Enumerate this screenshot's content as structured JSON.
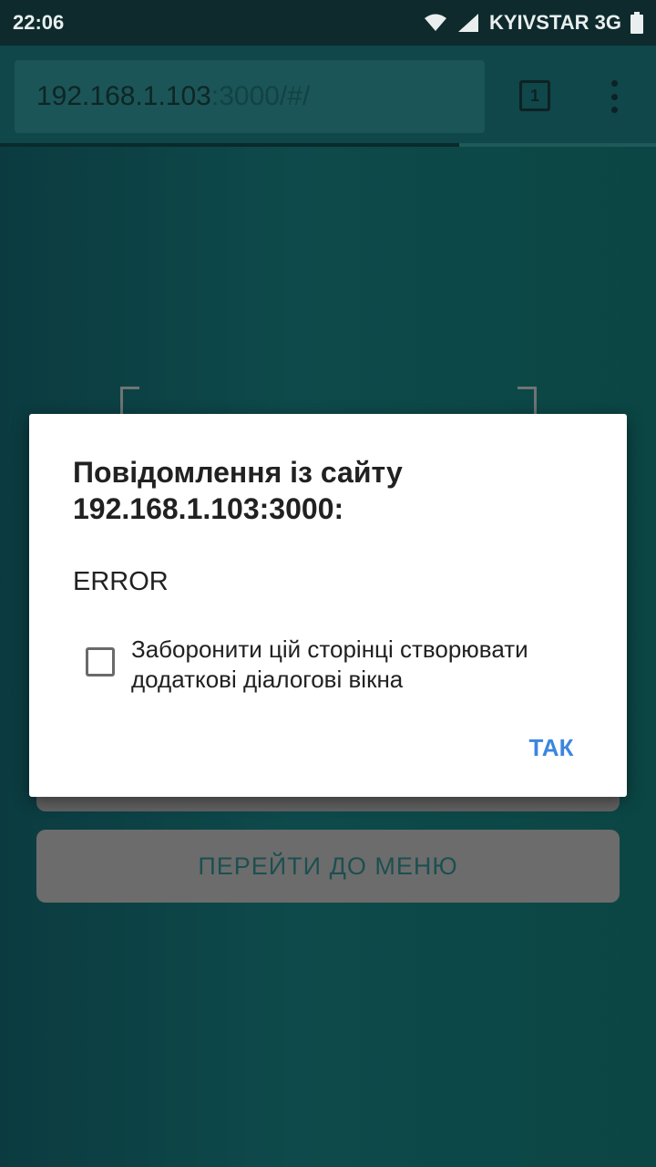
{
  "status_bar": {
    "time": "22:06",
    "carrier": "KYIVSTAR 3G"
  },
  "browser": {
    "url_host": "192.168.1.103",
    "url_rest": ":3000/#/",
    "tab_count": "1"
  },
  "page": {
    "menu_button_label": "ПЕРЕЙТИ ДО МЕНЮ"
  },
  "dialog": {
    "title_line1": "Повідомлення із сайту",
    "title_line2": "192.168.1.103:3000:",
    "message": "ERROR",
    "checkbox_label_line1": "Заборонити цій сторінці створювати",
    "checkbox_label_line2": "додаткові діалогові вікна",
    "ok_label": "ТАК"
  },
  "colors": {
    "accent": "#3b86e0",
    "status_bar_bg": "#0e2a2c",
    "toolbar_bg": "#10474a"
  }
}
